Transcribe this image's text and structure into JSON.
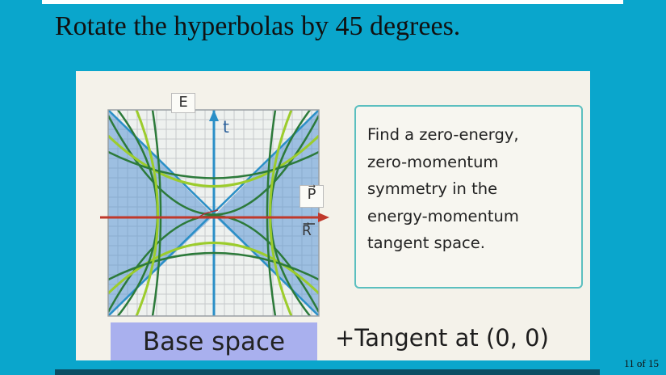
{
  "slide": {
    "title": "Rotate the hyperbolas by 45 degrees.",
    "page_indicator": "11 of 15"
  },
  "figure": {
    "axis_labels": {
      "E": "E",
      "t": "t",
      "P": "P⃗",
      "R": "R⃗"
    },
    "base_label": "Base space",
    "tangent_label": "+Tangent at (0, 0)"
  },
  "note": {
    "lines": [
      "Find a zero-energy,",
      "zero-momentum",
      "symmetry in the",
      "energy-momentum",
      "tangent space."
    ]
  },
  "colors": {
    "background": "#0aa6cc",
    "panel": "#f4f2ea",
    "base_label_bg": "#a9b0ee",
    "hyperbola_dark": "#2c7a3a",
    "hyperbola_light": "#9ccc2c",
    "asymptote": "#2a8fc7",
    "shading": "#5b95d6",
    "x_axis": "#c0392b"
  }
}
